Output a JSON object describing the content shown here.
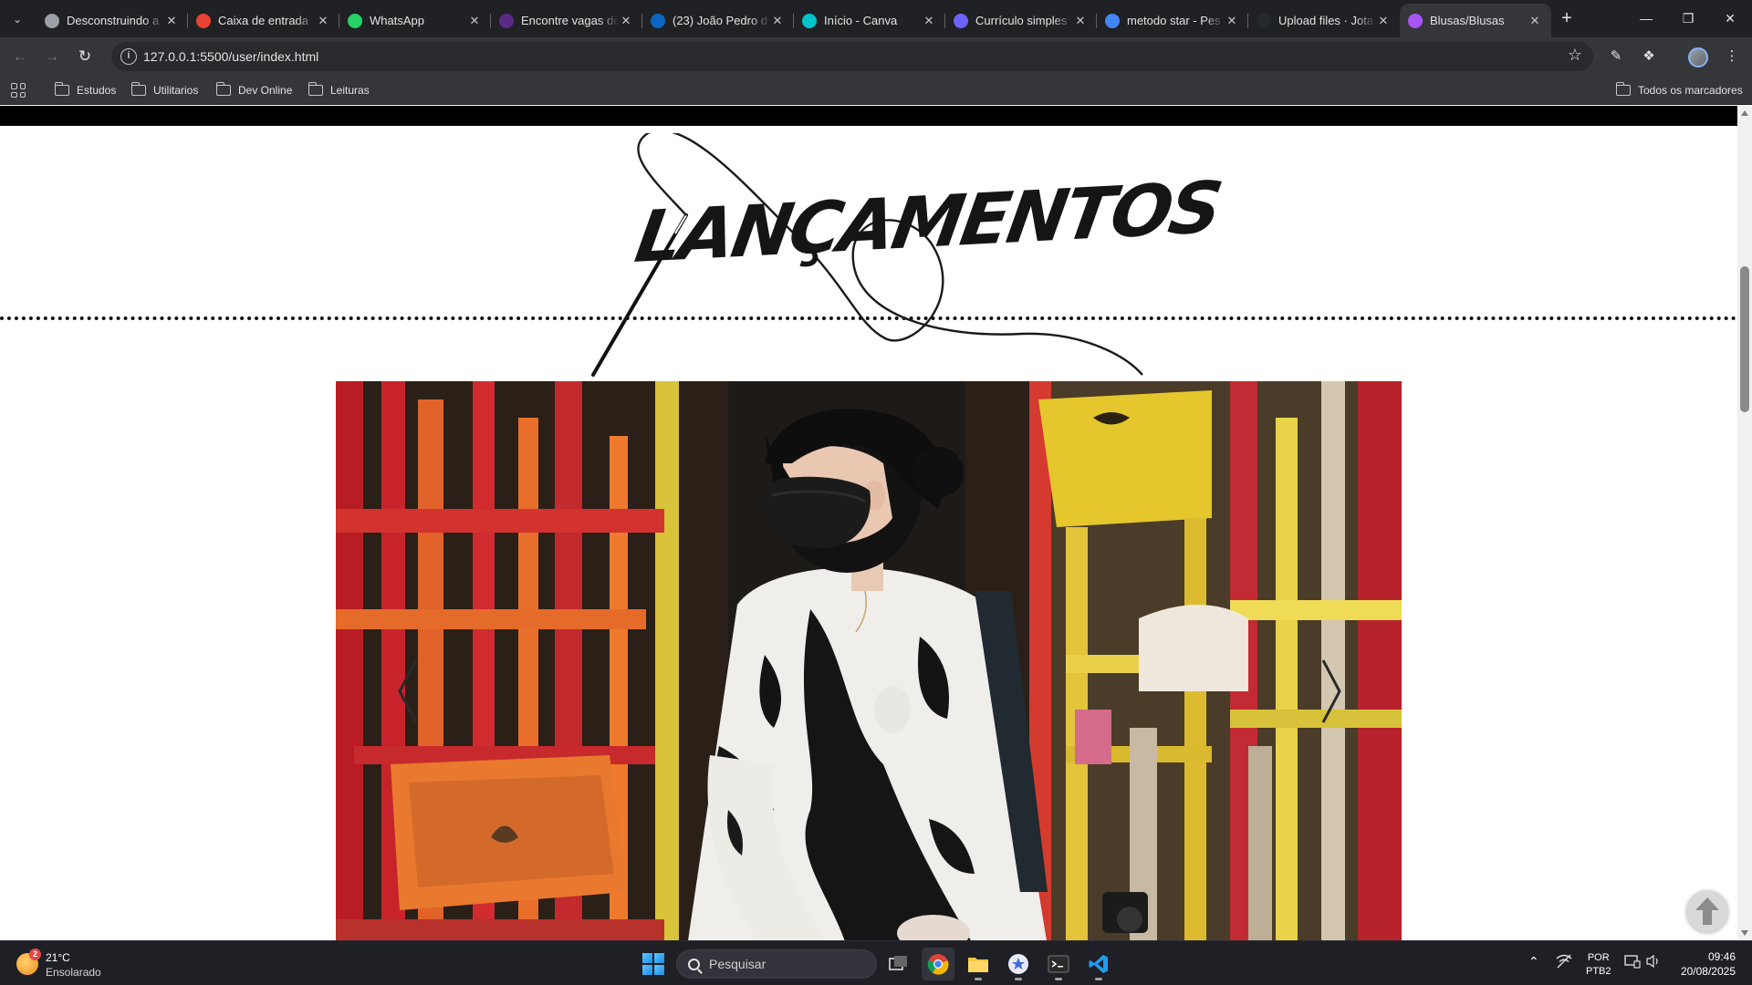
{
  "browser": {
    "tabs": [
      {
        "title": "Desconstruindo a",
        "icon": "globe-icon",
        "color": "#9aa0a6"
      },
      {
        "title": "Caixa de entrada",
        "icon": "gmail-icon",
        "color": "#ea4335"
      },
      {
        "title": "WhatsApp",
        "icon": "whatsapp-icon",
        "color": "#25d366"
      },
      {
        "title": "Encontre vagas de",
        "icon": "job-site-icon",
        "color": "#5b2a86"
      },
      {
        "title": "(23) João Pedro d",
        "icon": "linkedin-icon",
        "color": "#0a66c2"
      },
      {
        "title": "Início - Canva",
        "icon": "canva-icon",
        "color": "#00c4cc"
      },
      {
        "title": "Currículo simples",
        "icon": "document-icon",
        "color": "#6c63ff"
      },
      {
        "title": "metodo star - Pes",
        "icon": "google-icon",
        "color": "#4285f4"
      },
      {
        "title": "Upload files · Jota",
        "icon": "github-icon",
        "color": "#24292f"
      },
      {
        "title": "Blusas/Blusas",
        "icon": "tshirt-icon",
        "color": "#a855f7",
        "active": true
      }
    ],
    "url": "127.0.0.1:5500/user/index.html",
    "bookmarks": [
      "Estudos",
      "Utilitarios",
      "Dev Online",
      "Leituras"
    ],
    "all_bookmarks": "Todos os marcadores"
  },
  "page": {
    "heading": "Lançamentos",
    "hero_alt": "Pessoa de máscara preta e moletom branco e preto sentada entre cadeiras coloridas"
  },
  "taskbar": {
    "weather_temp": "21°C",
    "weather_desc": "Ensolarado",
    "weather_badge": "2",
    "search_placeholder": "Pesquisar",
    "lang_line1": "POR",
    "lang_line2": "PTB2",
    "time": "09:46",
    "date": "20/08/2025"
  }
}
